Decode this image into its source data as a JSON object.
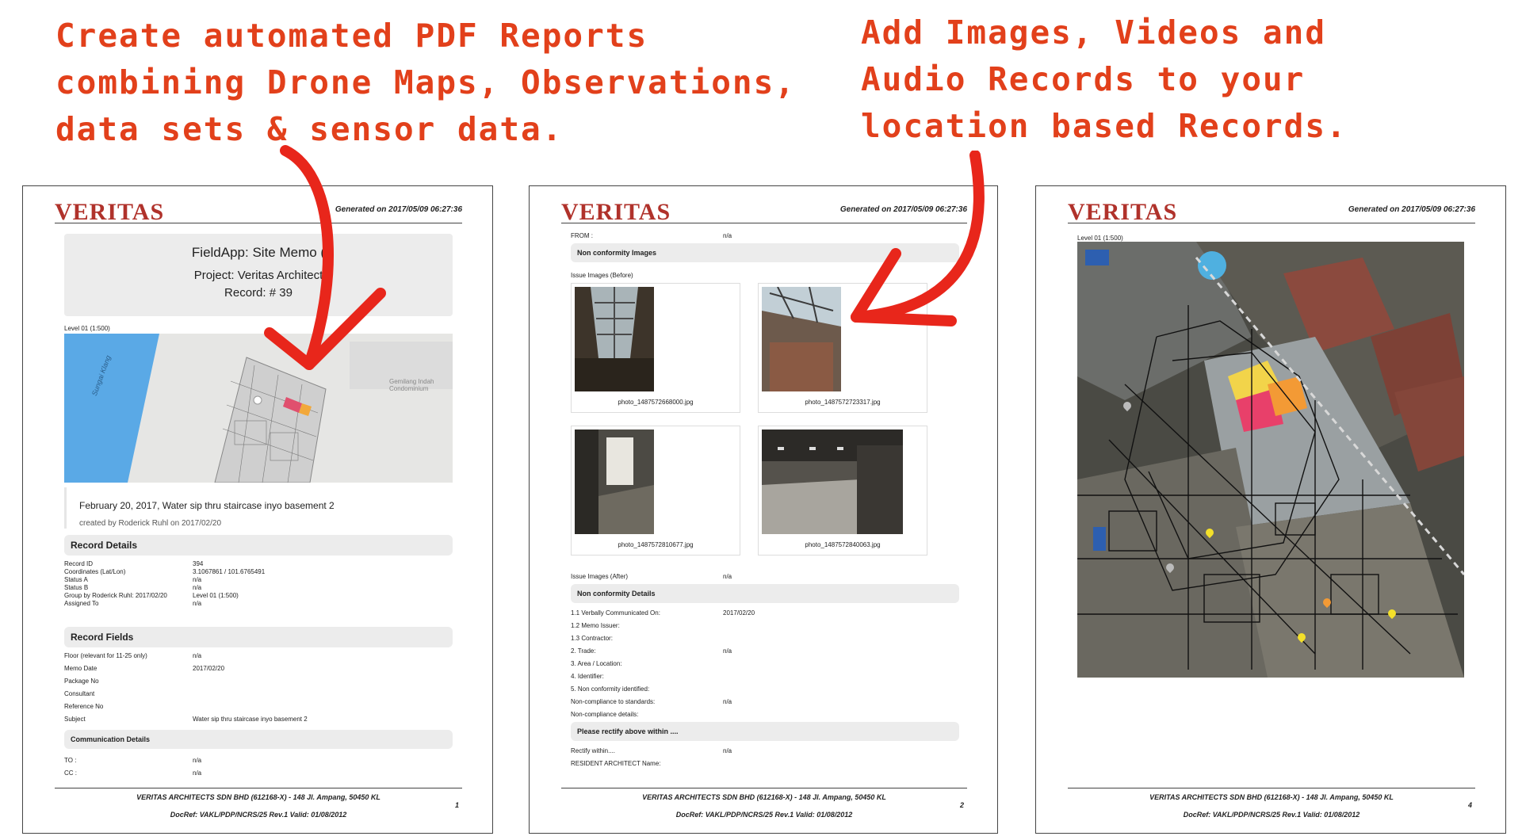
{
  "callouts": {
    "left": [
      "Create automated PDF Reports",
      "combining Drone Maps, Observations,",
      "data sets & sensor data."
    ],
    "right": [
      "Add Images, Videos and",
      "Audio Records to your",
      "location based Records."
    ]
  },
  "colors": {
    "accent": "#e2401b",
    "logo": "#b0322b",
    "section_bg": "#ececec"
  },
  "common": {
    "logo": "VERITAS",
    "generated": "Generated on 2017/05/09 06:27:36",
    "footer_line1": "VERITAS ARCHITECTS SDN BHD (612168-X) - 148 Jl. Ampang, 50450 KL",
    "footer_line2": "DocRef: VAKL/PDP/NCRS/25 Rev.1 Valid: 01/08/2012"
  },
  "page1": {
    "page_number": "1",
    "title": "FieldApp: Site Memo (",
    "project": "Project: Veritas Architect",
    "record": "Record: # 39",
    "map_label": "Level 01 (1:500)",
    "map_river": "Sungai Klang",
    "map_place": "Gemilang Indah Condominium",
    "memo_title": "February 20, 2017, Water sip thru staircase inyo basement 2",
    "memo_created": "created by Roderick Ruhl on 2017/02/20",
    "record_details_heading": "Record Details",
    "record_details": [
      {
        "label": "Record ID",
        "value": "394"
      },
      {
        "label": "Coordinates (Lat/Lon)",
        "value": "3.1067861 / 101.6765491"
      },
      {
        "label": "Status A",
        "value": "n/a"
      },
      {
        "label": "Status B",
        "value": "n/a"
      },
      {
        "label": "Group by Roderick Ruhl: 2017/02/20",
        "value": "Level 01 (1:500)"
      },
      {
        "label": "Assigned To",
        "value": "n/a"
      }
    ],
    "record_fields_heading": "Record Fields",
    "record_fields": [
      {
        "label": "Floor (relevant for 11-25 only)",
        "value": "n/a"
      },
      {
        "label": "Memo Date",
        "value": "2017/02/20"
      },
      {
        "label": "Package No",
        "value": ""
      },
      {
        "label": "Consultant",
        "value": ""
      },
      {
        "label": "Reference No",
        "value": ""
      },
      {
        "label": "Subject",
        "value": "Water sip thru staircase inyo basement 2"
      }
    ],
    "comm_heading": "Communication Details",
    "comm": [
      {
        "label": "TO :",
        "value": "n/a"
      },
      {
        "label": "CC :",
        "value": "n/a"
      }
    ]
  },
  "page2": {
    "page_number": "2",
    "from_label": "FROM :",
    "from_value": "n/a",
    "nc_images_heading": "Non conformity Images",
    "before_label": "Issue Images (Before)",
    "photos": [
      "photo_1487572668000.jpg",
      "photo_1487572723317.jpg",
      "photo_1487572810677.jpg",
      "photo_1487572840063.jpg"
    ],
    "after_label": "Issue Images (After)",
    "after_value": "n/a",
    "nc_details_heading": "Non conformity Details",
    "nc_details": [
      {
        "label": "1.1 Verbally Communicated On:",
        "value": "2017/02/20"
      },
      {
        "label": "1.2 Memo Issuer:",
        "value": ""
      },
      {
        "label": "1.3 Contractor:",
        "value": ""
      },
      {
        "label": "2. Trade:",
        "value": "n/a"
      },
      {
        "label": "3. Area / Location:",
        "value": ""
      },
      {
        "label": "4. Identifier:",
        "value": ""
      },
      {
        "label": "5. Non conformity identified:",
        "value": ""
      },
      {
        "label": "Non-compliance to standards:",
        "value": "n/a"
      },
      {
        "label": "Non-compliance details:",
        "value": ""
      }
    ],
    "rectify_heading": "Please rectify above within ....",
    "rectify": [
      {
        "label": "Rectify within....",
        "value": "n/a"
      },
      {
        "label": "RESIDENT ARCHITECT Name:",
        "value": ""
      }
    ]
  },
  "page3": {
    "page_number": "4",
    "map_label": "Level 01 (1:500)"
  }
}
